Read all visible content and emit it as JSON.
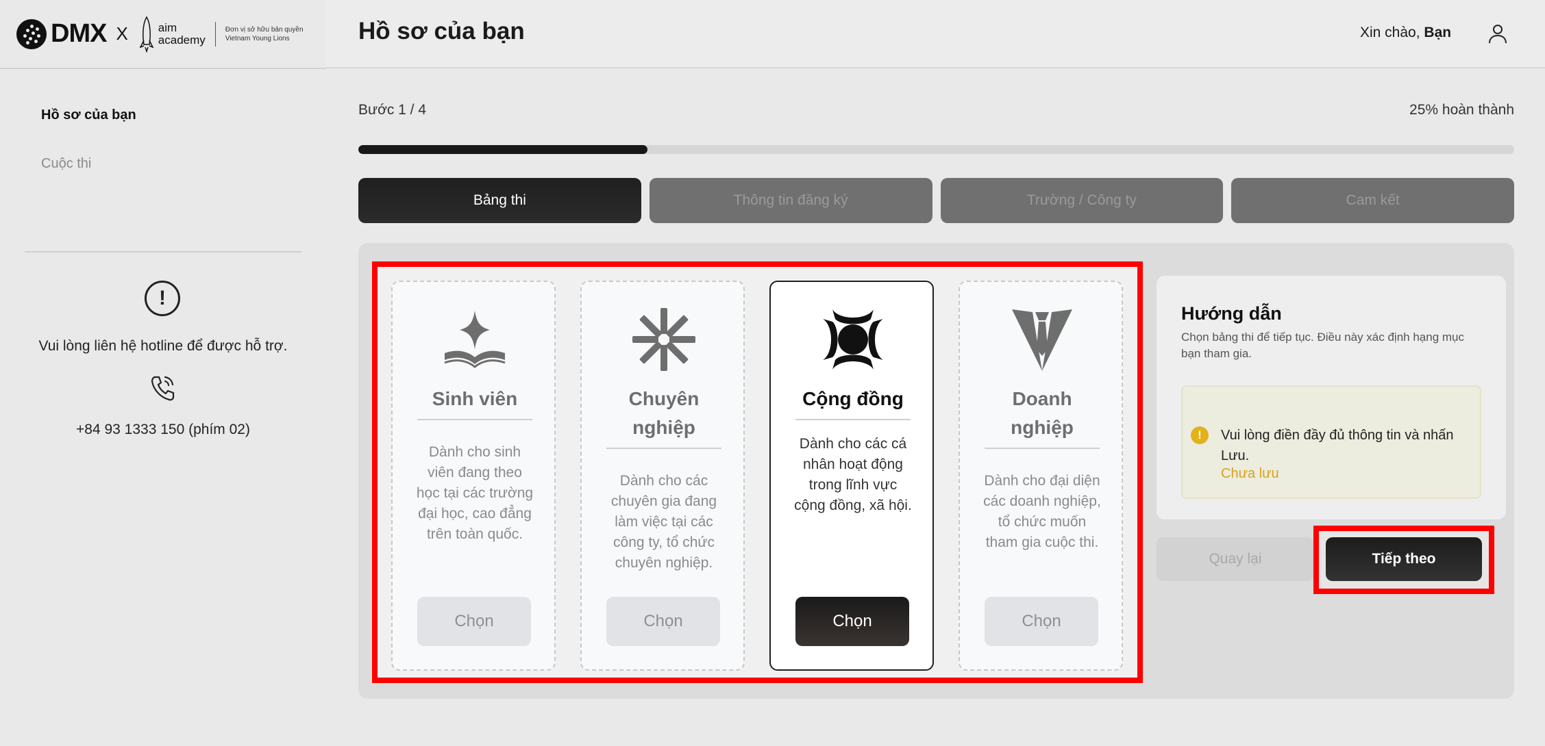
{
  "brand": {
    "dmx": "DMX",
    "x": "X",
    "aim_line1": "aim",
    "aim_line2": "academy",
    "aim_sub1": "Đơn vị sở hữu bản quyền",
    "aim_sub2": "Vietnam Young Lions"
  },
  "sidebar": {
    "items": [
      {
        "label": "Hồ sơ của bạn",
        "active": true
      },
      {
        "label": "Cuộc thi",
        "active": false
      }
    ],
    "help_text": "Vui lòng liên hệ hotline để được hỗ trợ.",
    "hotline": "+84 93 1333 150 (phím 02)"
  },
  "header": {
    "title": "Hồ sơ của bạn",
    "greeting": "Xin chào,",
    "user_name": "Bạn"
  },
  "progress": {
    "step_text": "Bước 1 / 4",
    "complete_text": "25% hoàn thành",
    "fraction": 0.25
  },
  "tabs": [
    {
      "label": "Bảng thi",
      "active": true
    },
    {
      "label": "Thông tin đăng ký",
      "active": false
    },
    {
      "label": "Trường / Công ty",
      "active": false
    },
    {
      "label": "Cam kết",
      "active": false
    }
  ],
  "cards": [
    {
      "icon": "book-star-icon",
      "title": "Sinh viên",
      "desc": "Dành cho sinh viên đang theo học tại các trường đại học, cao đẳng trên toàn quốc.",
      "button": "Chọn",
      "selected": false
    },
    {
      "icon": "asterisk-icon",
      "title": "Chuyên nghiệp",
      "desc": "Dành cho các chuyên gia đang làm việc tại các công ty, tổ chức chuyên nghiệp.",
      "button": "Chọn",
      "selected": false
    },
    {
      "icon": "community-circle-icon",
      "title": "Cộng đồng",
      "desc": "Dành cho các cá nhân hoạt động trong lĩnh vực cộng đồng, xã hội.",
      "button": "Chọn",
      "selected": true
    },
    {
      "icon": "suit-tie-icon",
      "title": "Doanh nghiệp",
      "desc": "Dành cho đại diện các doanh nghiệp, tổ chức muốn tham gia cuộc thi.",
      "button": "Chọn",
      "selected": false
    }
  ],
  "guide": {
    "title": "Hướng dẫn",
    "text": "Chọn bảng thi để tiếp tục. Điều này xác định hạng mục bạn tham gia.",
    "warning": "Vui lòng điền đầy đủ thông tin và nhấn Lưu.",
    "status": "Chưa lưu"
  },
  "actions": {
    "back": "Quay lại",
    "next": "Tiếp theo"
  },
  "colors": {
    "accent_dark": "#1f1f1f",
    "highlight": "#ff0000",
    "warning": "#e3b21b"
  }
}
